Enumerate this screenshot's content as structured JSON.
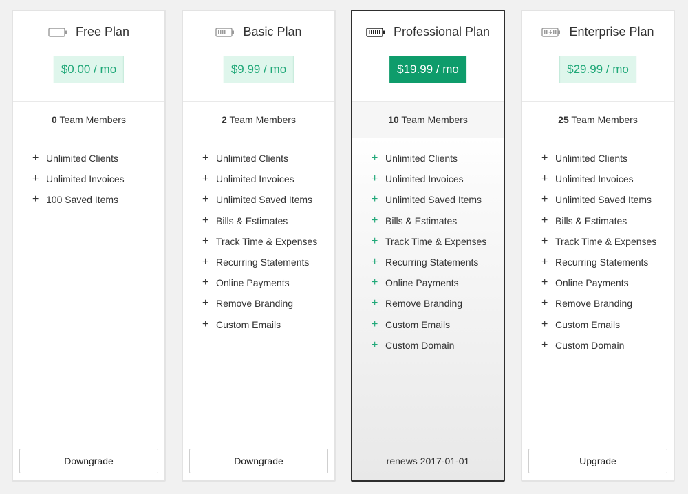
{
  "plans": [
    {
      "icon": "battery-empty-icon",
      "name": "Free Plan",
      "price": "$0.00 / mo",
      "members_count": "0",
      "members_label": "Team Members",
      "features": [
        "Unlimited Clients",
        "Unlimited Invoices",
        "100 Saved Items"
      ],
      "action_label": "Downgrade"
    },
    {
      "icon": "battery-low-icon",
      "name": "Basic Plan",
      "price": "$9.99 / mo",
      "members_count": "2",
      "members_label": "Team Members",
      "features": [
        "Unlimited Clients",
        "Unlimited Invoices",
        "Unlimited Saved Items",
        "Bills & Estimates",
        "Track Time & Expenses",
        "Recurring Statements",
        "Online Payments",
        "Remove Branding",
        "Custom Emails"
      ],
      "action_label": "Downgrade"
    },
    {
      "icon": "battery-full-icon",
      "name": "Professional Plan",
      "price": "$19.99 / mo",
      "members_count": "10",
      "members_label": "Team Members",
      "features": [
        "Unlimited Clients",
        "Unlimited Invoices",
        "Unlimited Saved Items",
        "Bills & Estimates",
        "Track Time & Expenses",
        "Recurring Statements",
        "Online Payments",
        "Remove Branding",
        "Custom Emails",
        "Custom Domain"
      ],
      "renews": "renews 2017-01-01"
    },
    {
      "icon": "battery-charging-icon",
      "name": "Enterprise Plan",
      "price": "$29.99 / mo",
      "members_count": "25",
      "members_label": "Team Members",
      "features": [
        "Unlimited Clients",
        "Unlimited Invoices",
        "Unlimited Saved Items",
        "Bills & Estimates",
        "Track Time & Expenses",
        "Recurring Statements",
        "Online Payments",
        "Remove Branding",
        "Custom Emails",
        "Custom Domain"
      ],
      "action_label": "Upgrade"
    }
  ],
  "colors": {
    "accent": "#1fa878",
    "accent_dark": "#0e9c6b",
    "price_bg": "#dff6ec",
    "current_border": "#2e2e2e"
  }
}
